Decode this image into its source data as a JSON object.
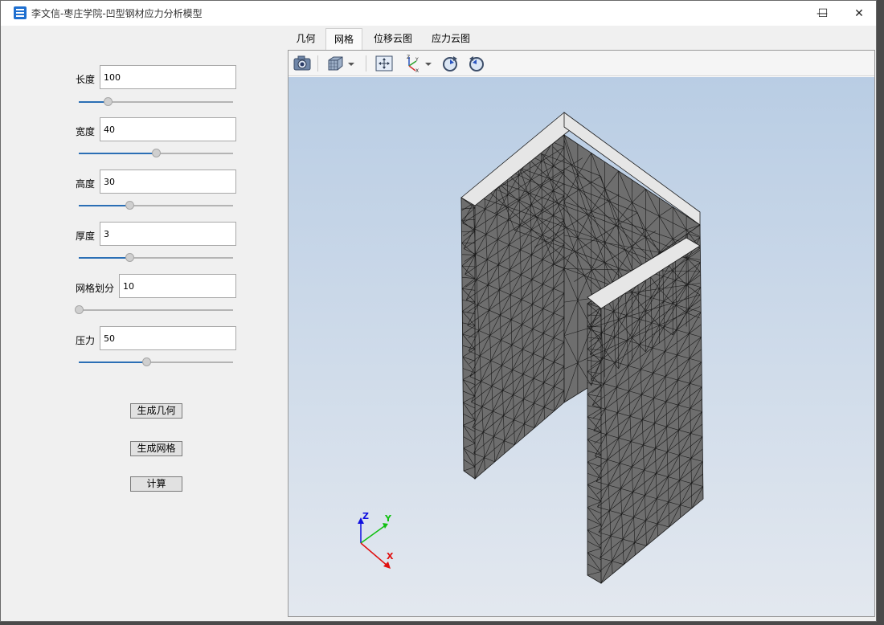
{
  "window": {
    "title": "李文信-枣庄学院-凹型钢材应力分析模型",
    "minimize_glyph": "—",
    "maximize_glyph": "☐",
    "close_glyph": "✕"
  },
  "params": [
    {
      "label": "长度",
      "value": "100",
      "slider": 0.19
    },
    {
      "label": "宽度",
      "value": "40",
      "slider": 0.5
    },
    {
      "label": "高度",
      "value": "30",
      "slider": 0.33
    },
    {
      "label": "厚度",
      "value": "3",
      "slider": 0.33
    },
    {
      "label": "网格划分",
      "value": "10",
      "slider": 0.0
    },
    {
      "label": "压力",
      "value": "50",
      "slider": 0.44
    }
  ],
  "buttons": {
    "generate_geometry": "生成几何",
    "generate_mesh": "生成网格",
    "compute": "计算"
  },
  "tabs": [
    {
      "label": "几何",
      "active": false
    },
    {
      "label": "网格",
      "active": true
    },
    {
      "label": "位移云图",
      "active": false
    },
    {
      "label": "应力云图",
      "active": false
    }
  ],
  "toolbar": {
    "icons": [
      "camera-icon",
      "view-cube-icon",
      "dropdown-arrow-icon",
      "fit-all-icon",
      "axes-icon",
      "dropdown-arrow-icon",
      "rotate-cw-icon",
      "rotate-ccw-icon"
    ]
  },
  "triad": {
    "x_label": "X",
    "y_label": "Y",
    "z_label": "Z",
    "x_color": "#e01010",
    "y_color": "#10c010",
    "z_color": "#1010e0"
  },
  "colors": {
    "accent": "#2b6fb5",
    "mesh_face": "#6e6e6e",
    "mesh_cap": "#e6e6e6",
    "mesh_line": "#1a1a1a"
  }
}
